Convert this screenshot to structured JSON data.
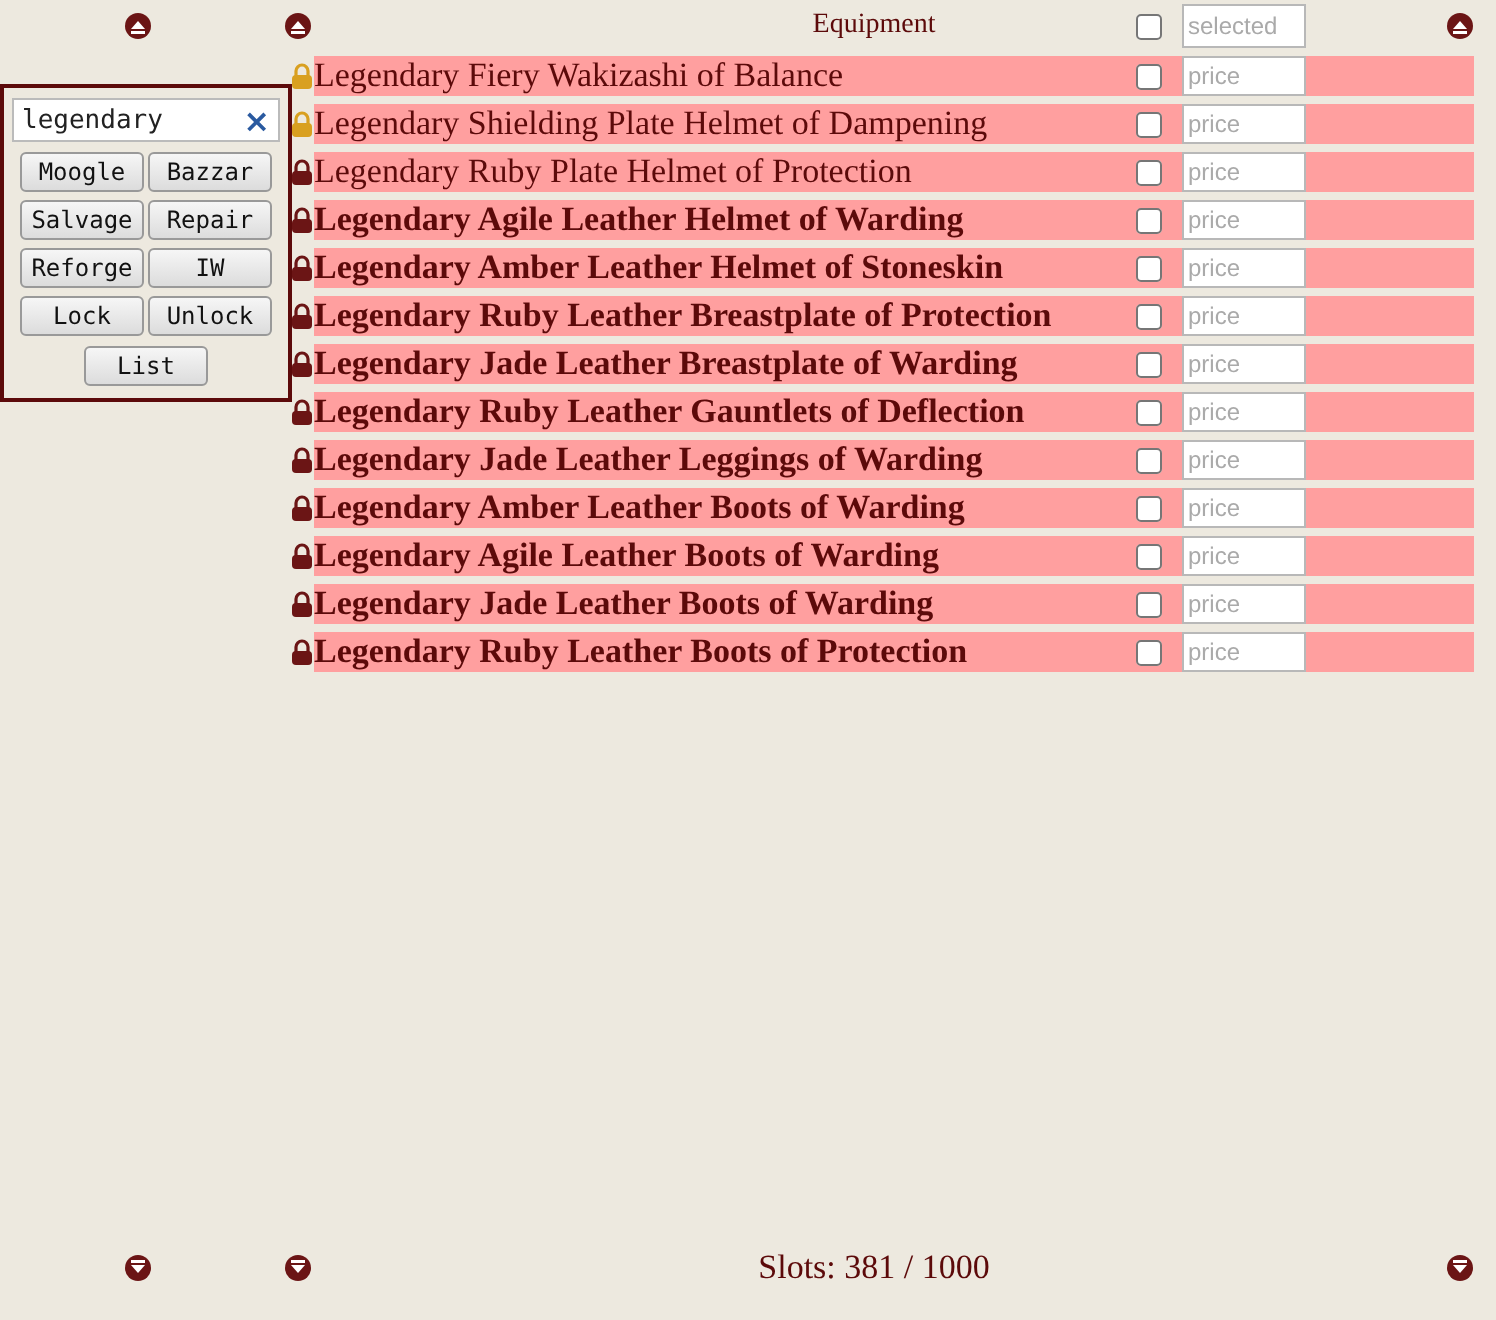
{
  "header": {
    "title": "Equipment",
    "select_all": {
      "checked": false
    },
    "selected_field": {
      "placeholder": "selected"
    }
  },
  "panel": {
    "search": {
      "value": "legendary",
      "clear": "×"
    },
    "buttons": [
      "Moogle",
      "Bazzar",
      "Salvage",
      "Repair",
      "Reforge",
      "IW",
      "Lock",
      "Unlock"
    ],
    "list_button": "List"
  },
  "items": [
    {
      "name": "Legendary Fiery Wakizashi of Balance",
      "locked": false,
      "bold": false,
      "checked": false,
      "price_placeholder": "price"
    },
    {
      "name": "Legendary Shielding Plate Helmet of Dampening",
      "locked": false,
      "bold": false,
      "checked": false,
      "price_placeholder": "price"
    },
    {
      "name": "Legendary Ruby Plate Helmet of Protection",
      "locked": true,
      "bold": false,
      "checked": false,
      "price_placeholder": "price"
    },
    {
      "name": "Legendary Agile Leather Helmet of Warding",
      "locked": true,
      "bold": true,
      "checked": false,
      "price_placeholder": "price"
    },
    {
      "name": "Legendary Amber Leather Helmet of Stoneskin",
      "locked": true,
      "bold": true,
      "checked": false,
      "price_placeholder": "price"
    },
    {
      "name": "Legendary Ruby Leather Breastplate of Protection",
      "locked": true,
      "bold": true,
      "checked": false,
      "price_placeholder": "price"
    },
    {
      "name": "Legendary Jade Leather Breastplate of Warding",
      "locked": true,
      "bold": true,
      "checked": false,
      "price_placeholder": "price"
    },
    {
      "name": "Legendary Ruby Leather Gauntlets of Deflection",
      "locked": true,
      "bold": true,
      "checked": false,
      "price_placeholder": "price"
    },
    {
      "name": "Legendary Jade Leather Leggings of Warding",
      "locked": true,
      "bold": true,
      "checked": false,
      "price_placeholder": "price"
    },
    {
      "name": "Legendary Amber Leather Boots of Warding",
      "locked": true,
      "bold": true,
      "checked": false,
      "price_placeholder": "price"
    },
    {
      "name": "Legendary Agile Leather Boots of Warding",
      "locked": true,
      "bold": true,
      "checked": false,
      "price_placeholder": "price"
    },
    {
      "name": "Legendary Jade Leather Boots of Warding",
      "locked": true,
      "bold": true,
      "checked": false,
      "price_placeholder": "price"
    },
    {
      "name": "Legendary Ruby Leather Boots of Protection",
      "locked": true,
      "bold": true,
      "checked": false,
      "price_placeholder": "price"
    }
  ],
  "footer": {
    "slots": "Slots: 381 / 1000"
  }
}
